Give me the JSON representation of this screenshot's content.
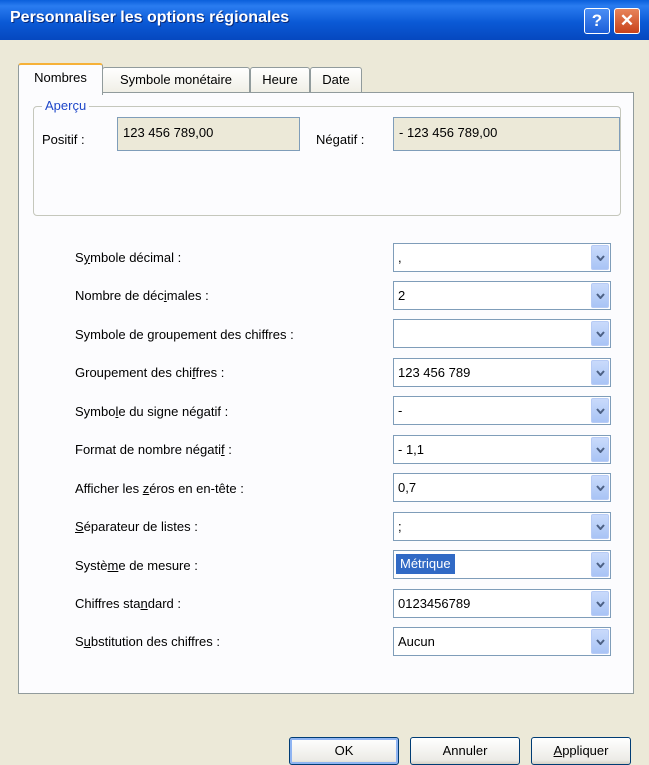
{
  "window": {
    "title": "Personnaliser les options régionales",
    "help_label": "?",
    "close_label": "✕"
  },
  "tabs": [
    {
      "label": "Nombres",
      "active": true
    },
    {
      "label": "Symbole monétaire",
      "active": false
    },
    {
      "label": "Heure",
      "active": false
    },
    {
      "label": "Date",
      "active": false
    }
  ],
  "preview": {
    "legend": "Aperçu",
    "positive_label": "Positif :",
    "positive_value": "123 456 789,00",
    "negative_label": "Négatif :",
    "negative_value": "- 123 456 789,00"
  },
  "settings": [
    {
      "label": "Symbole décimal :",
      "value": ","
    },
    {
      "label": "Nombre de décimales :",
      "value": "2"
    },
    {
      "label": "Symbole de groupement des chiffres :",
      "value": ""
    },
    {
      "label": "Groupement des chiffres :",
      "value": "123 456 789"
    },
    {
      "label": "Symbole du signe négatif :",
      "value": "-"
    },
    {
      "label": "Format de nombre négatif :",
      "value": "- 1,1"
    },
    {
      "label": "Afficher les zéros en en-tête :",
      "value": "0,7"
    },
    {
      "label": "Séparateur de listes :",
      "value": ";"
    },
    {
      "label": "Système de mesure :",
      "value": "Métrique"
    },
    {
      "label": "Chiffres standard :",
      "value": "0123456789"
    },
    {
      "label": "Substitution des chiffres :",
      "value": "Aucun"
    }
  ],
  "buttons": {
    "ok": "OK",
    "cancel": "Annuler",
    "apply": "Appliquer"
  }
}
